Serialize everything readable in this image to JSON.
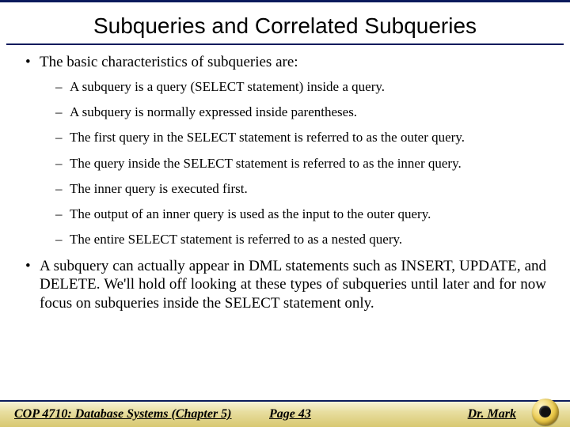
{
  "title": "Subqueries and Correlated Subqueries",
  "bullets": {
    "main0": "The basic characteristics of subqueries are:",
    "sub": [
      "A subquery is a query (SELECT statement) inside a query.",
      "A subquery is normally expressed inside parentheses.",
      "The first query in the SELECT statement is referred to as the outer query.",
      "The query inside the SELECT statement is referred to as the inner query.",
      "The inner query is executed first.",
      "The output of an inner query is used as the input to the outer query.",
      "The entire SELECT statement is referred to as a nested query."
    ],
    "main1": "A subquery can actually appear in DML statements such as INSERT, UPDATE, and DELETE.  We'll hold off looking at these types of subqueries until later and for now focus on subqueries inside the SELECT statement only."
  },
  "footer": {
    "left": "COP 4710: Database Systems  (Chapter 5)",
    "center": "Page 43",
    "right": "Dr. Mark"
  }
}
